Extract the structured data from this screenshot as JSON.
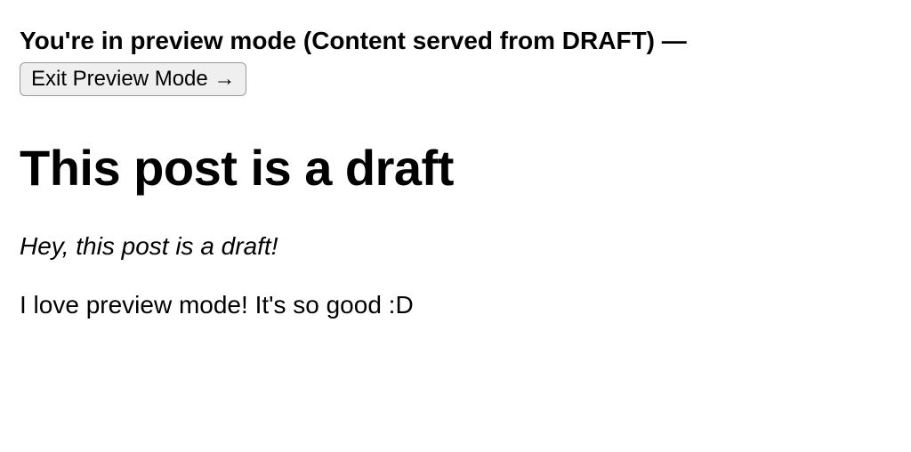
{
  "banner": {
    "text": "You're in preview mode (Content served from DRAFT) —",
    "exit_label": "Exit Preview Mode →"
  },
  "post": {
    "title": "This post is a draft",
    "intro": "Hey, this post is a draft!",
    "body": "I love preview mode! It's so good :D"
  }
}
